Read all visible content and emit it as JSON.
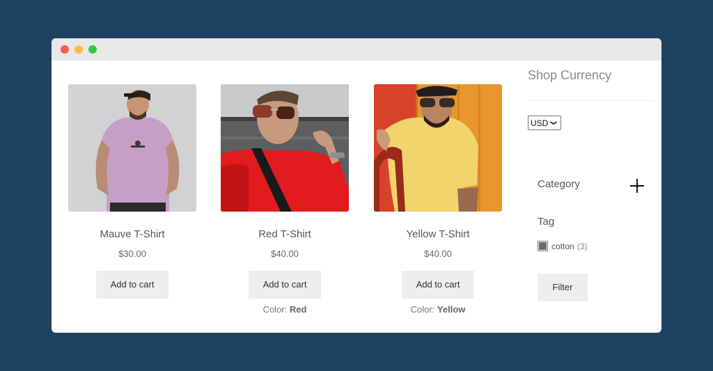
{
  "window": {
    "controls": [
      "close",
      "minimize",
      "maximize"
    ]
  },
  "products": [
    {
      "name": "Mauve T-Shirt",
      "price": "$30.00",
      "button_label": "Add to cart",
      "color_label": "",
      "color_value": "",
      "image": "man-in-mauve-tshirt-photo",
      "shirt_color": "#c9a2c9"
    },
    {
      "name": "Red T-Shirt",
      "price": "$40.00",
      "button_label": "Add to cart",
      "color_label": "Color: ",
      "color_value": "Red",
      "image": "man-in-red-tshirt-photo",
      "shirt_color": "#e01f22"
    },
    {
      "name": "Yellow T-Shirt",
      "price": "$40.00",
      "button_label": "Add to cart",
      "color_label": "Color: ",
      "color_value": "Yellow",
      "image": "man-in-yellow-tshirt-photo",
      "shirt_color": "#f1d46a"
    }
  ],
  "sidebar": {
    "currency_title": "Shop Currency",
    "currency_selected": "USD",
    "category_label": "Category",
    "category_toggle_icon": "plus-icon",
    "tag_label": "Tag",
    "tags": [
      {
        "label": "cotton",
        "count": "(3)",
        "checked": true
      }
    ],
    "filter_label": "Filter"
  }
}
